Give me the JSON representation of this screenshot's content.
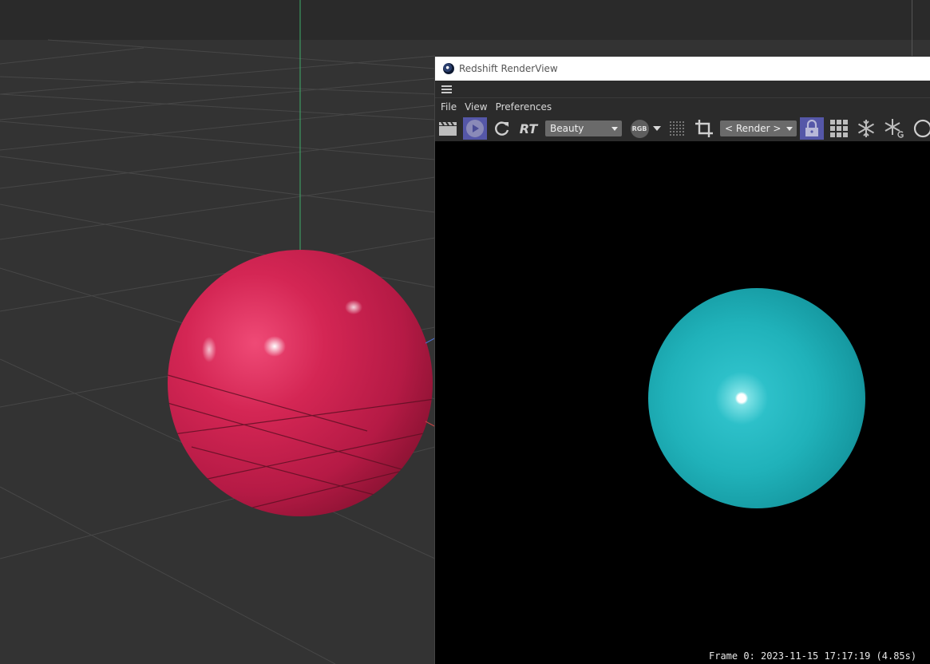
{
  "viewport": {
    "grid_color": "#474747",
    "y_axis_color": "#3fae6a",
    "sphere_color": "#c4204a"
  },
  "renderview": {
    "title": "Redshift RenderView",
    "menu": [
      "File",
      "View",
      "Preferences"
    ],
    "toolbar": {
      "rt_label": "RT",
      "aov_dropdown": "Beauty",
      "channel_badge": "RGB",
      "snapshot_dropdown": "< Render >"
    },
    "status": "Frame  0: 2023-11-15  17:17:19  (4.85s)",
    "render_sphere_color": "#22b6bf",
    "accent_color": "#5557a8"
  }
}
